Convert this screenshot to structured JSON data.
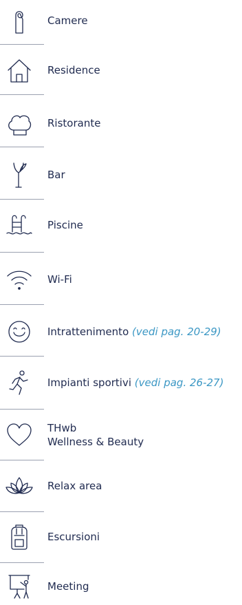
{
  "colors": {
    "text": "#1f2a4f",
    "note": "#3b97c4",
    "divider": "#9aa0b0"
  },
  "items": [
    {
      "icon": "door-hanger-icon",
      "label": "Camere"
    },
    {
      "icon": "house-icon",
      "label": "Residence"
    },
    {
      "icon": "chef-hat-icon",
      "label": "Ristorante"
    },
    {
      "icon": "cocktail-glass-icon",
      "label": "Bar"
    },
    {
      "icon": "pool-ladder-icon",
      "label": "Piscine"
    },
    {
      "icon": "wifi-icon",
      "label": "Wi-Fi"
    },
    {
      "icon": "smiley-icon",
      "label": "Intrattenimento",
      "note": "(vedi pag. 20-29)"
    },
    {
      "icon": "runner-icon",
      "label": "Impianti sportivi",
      "note": "(vedi pag. 26-27)"
    },
    {
      "icon": "heart-icon",
      "label": "THwb",
      "label2": "Wellness & Beauty"
    },
    {
      "icon": "lotus-icon",
      "label": "Relax area"
    },
    {
      "icon": "backpack-icon",
      "label": "Escursioni"
    },
    {
      "icon": "presentation-board-icon",
      "label": "Meeting"
    }
  ]
}
